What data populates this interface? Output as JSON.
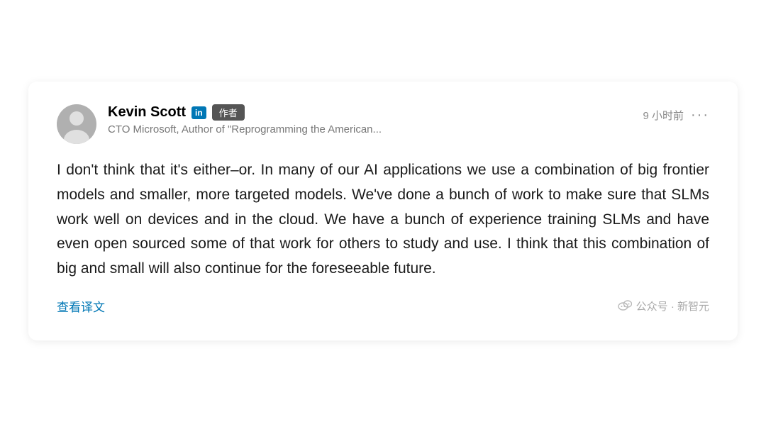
{
  "card": {
    "author": {
      "name": "Kevin Scott",
      "linkedin_label": "in",
      "author_badge": "作者",
      "subtitle": "CTO Microsoft, Author of \"Reprogramming the American..."
    },
    "meta": {
      "time": "9 小时前",
      "dots": "···"
    },
    "body": "I don't think that it's either–or. In many of our AI applications we use a combination of big frontier models and smaller, more targeted models. We've done a bunch of work to make sure that SLMs work well on devices and in the cloud. We have a bunch of experience training SLMs and have even open sourced some of that work for others to study and use. I think that this combination of big and small will also continue for the foreseeable future.",
    "footer": {
      "translate": "查看译文",
      "watermark": "公众号 · 新智元"
    }
  }
}
